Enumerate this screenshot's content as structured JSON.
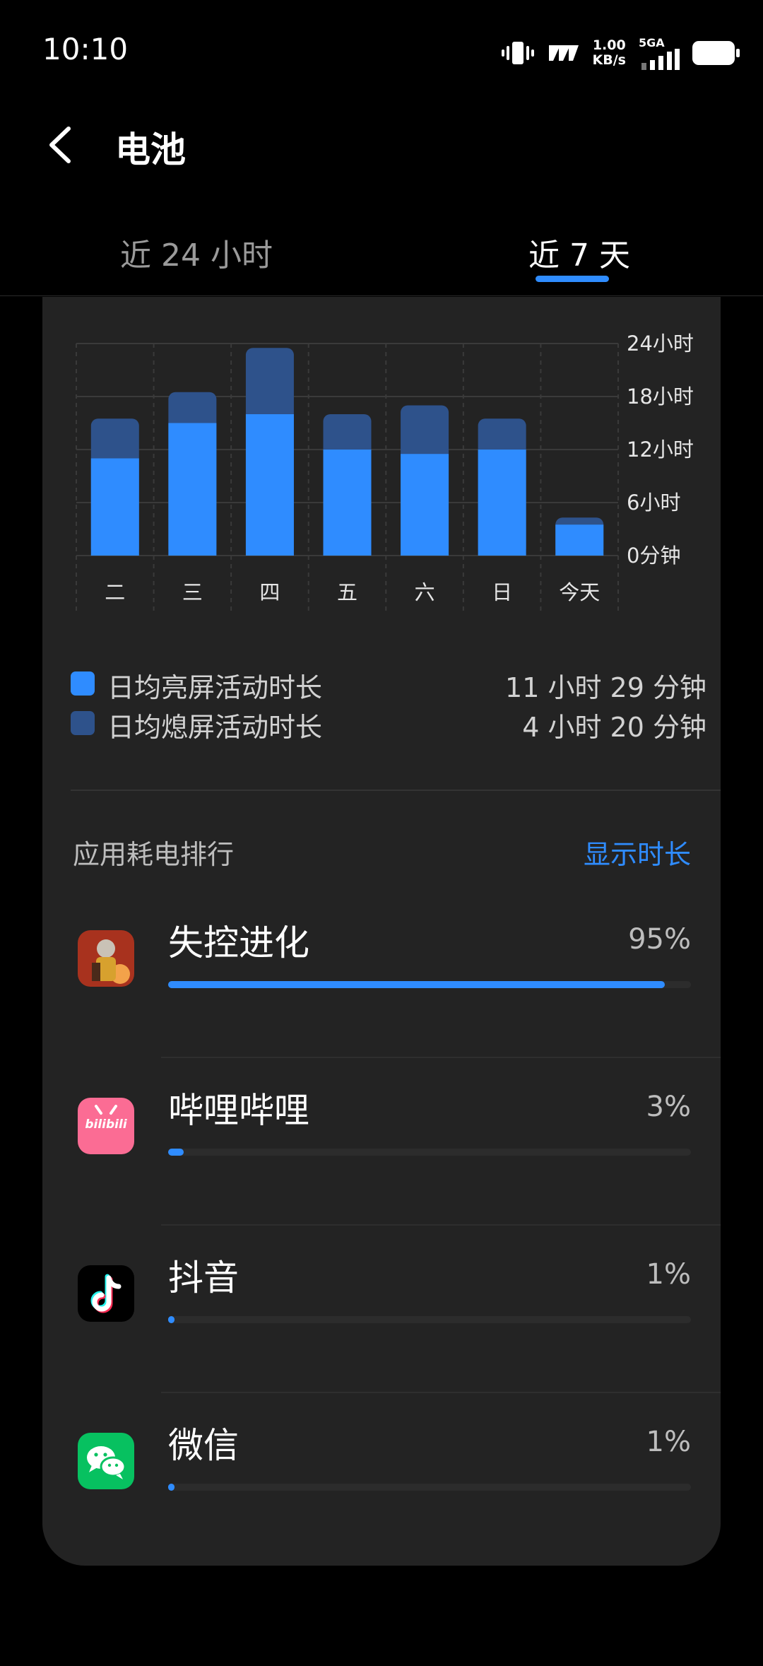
{
  "status_bar": {
    "time": "10:10",
    "net_speed_value": "1.00",
    "net_speed_unit": "KB/s",
    "network": "5GA"
  },
  "header": {
    "title": "电池"
  },
  "tabs": [
    {
      "label": "近 24 小时",
      "selected": false
    },
    {
      "label": "近 7 天",
      "selected": true
    }
  ],
  "chart_data": {
    "type": "bar",
    "stacked": true,
    "categories": [
      "二",
      "三",
      "四",
      "五",
      "六",
      "日",
      "今天"
    ],
    "series": [
      {
        "name": "日均亮屏活动时长",
        "color": "#2f8cff",
        "values": [
          11,
          15,
          16,
          12,
          11.5,
          12,
          3.5
        ]
      },
      {
        "name": "日均熄屏活动时长",
        "color": "#2e528b",
        "values": [
          4.5,
          3.5,
          7.5,
          4,
          5.5,
          3.5,
          0.8
        ]
      }
    ],
    "y_ticks": [
      "24小时",
      "18小时",
      "12小时",
      "6小时",
      "0分钟"
    ],
    "ylim": [
      0,
      24
    ],
    "grid": true
  },
  "legend": [
    {
      "label": "日均亮屏活动时长",
      "value": "11 小时 29 分钟",
      "color": "#2f8cff"
    },
    {
      "label": "日均熄屏活动时长",
      "value": "4 小时 20 分钟",
      "color": "#2e528b"
    }
  ],
  "ranking": {
    "title": "应用耗电排行",
    "toggle_label": "显示时长",
    "apps": [
      {
        "name": "失控进化",
        "percent_label": "95%",
        "percent": 95,
        "icon": "rust-game-icon"
      },
      {
        "name": "哔哩哔哩",
        "percent_label": "3%",
        "percent": 3,
        "icon": "bilibili-icon",
        "icon_text": "bilibili"
      },
      {
        "name": "抖音",
        "percent_label": "1%",
        "percent": 1,
        "icon": "douyin-icon"
      },
      {
        "name": "微信",
        "percent_label": "1%",
        "percent": 1,
        "icon": "wechat-icon"
      }
    ]
  }
}
